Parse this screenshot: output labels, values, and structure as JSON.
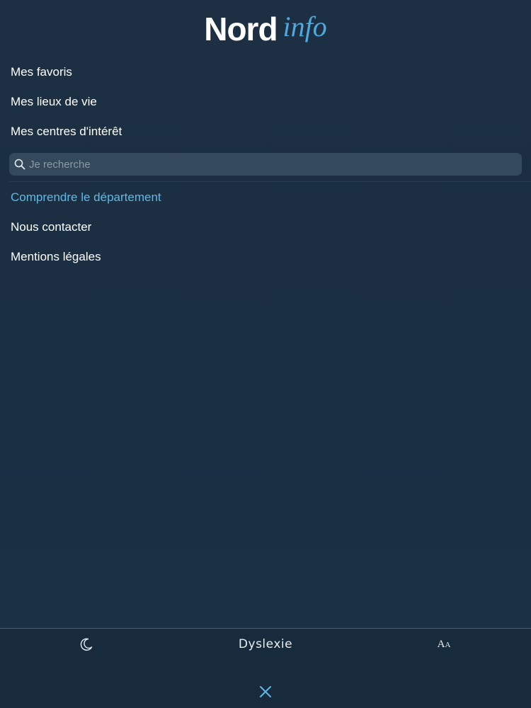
{
  "header": {
    "logo_main": "Nord",
    "logo_accent": "info"
  },
  "menu": {
    "items": [
      {
        "label": "Mes favoris"
      },
      {
        "label": "Mes lieux de vie"
      },
      {
        "label": "Mes centres d'intérêt"
      }
    ]
  },
  "search": {
    "placeholder": "Je recherche",
    "value": ""
  },
  "secondary_menu": {
    "items": [
      {
        "label": "Comprendre le département",
        "accent": true
      },
      {
        "label": "Nous contacter"
      },
      {
        "label": "Mentions légales"
      }
    ]
  },
  "footer": {
    "dyslexia_label": "Dyslexie",
    "moon_icon": "moon-icon",
    "text_size_icon": "text-size-icon",
    "text_size_glyph_big": "A",
    "text_size_glyph_small": "A",
    "close_icon": "close-icon"
  },
  "colors": {
    "background": "#1b2e42",
    "accent": "#5fb9e6",
    "logo_accent": "#4ea9dd",
    "search_bg": "#34495b"
  }
}
